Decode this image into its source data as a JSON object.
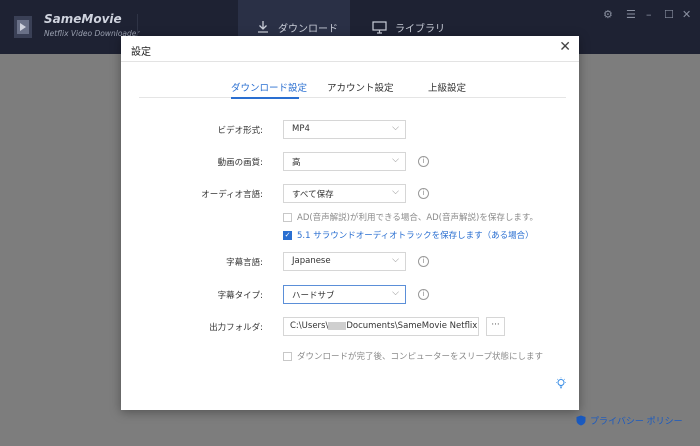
{
  "app": {
    "name": "SameMovie",
    "subtitle": "Netflix Video Downloader"
  },
  "nav": {
    "download": "ダウンロード",
    "library": "ライブラリ"
  },
  "footer": {
    "privacy": "プライバシー ポリシー"
  },
  "dialog": {
    "title": "設定",
    "tabs": [
      "ダウンロード設定",
      "アカウント設定",
      "上級設定"
    ],
    "rows": {
      "video_format": {
        "label": "ビデオ形式:",
        "value": "MP4"
      },
      "video_quality": {
        "label": "動画の画質:",
        "value": "高"
      },
      "audio_language": {
        "label": "オーディオ言語:",
        "value": "すべて保存"
      },
      "subtitle_language": {
        "label": "字幕言語:",
        "value": "Japanese"
      },
      "subtitle_type": {
        "label": "字幕タイプ:",
        "value": "ハードサブ"
      },
      "output_folder": {
        "label": "出力フォルダ:",
        "value_prefix": "C:\\Users\\",
        "value_suffix": "Documents\\SameMovie Netflix"
      }
    },
    "checks": {
      "ad": {
        "label": "AD(音声解説)が利用できる場合、AD(音声解説)を保存します。",
        "checked": false
      },
      "surround": {
        "label": "5.1 サラウンドオーディオトラックを保存します（ある場合）",
        "checked": true
      },
      "sleep": {
        "label": "ダウンロードが完了後、コンピューターをスリープ状態にします",
        "checked": false
      }
    },
    "more_button": "···"
  },
  "colors": {
    "accent": "#2a6fd1",
    "topbar": "#1e2233"
  }
}
